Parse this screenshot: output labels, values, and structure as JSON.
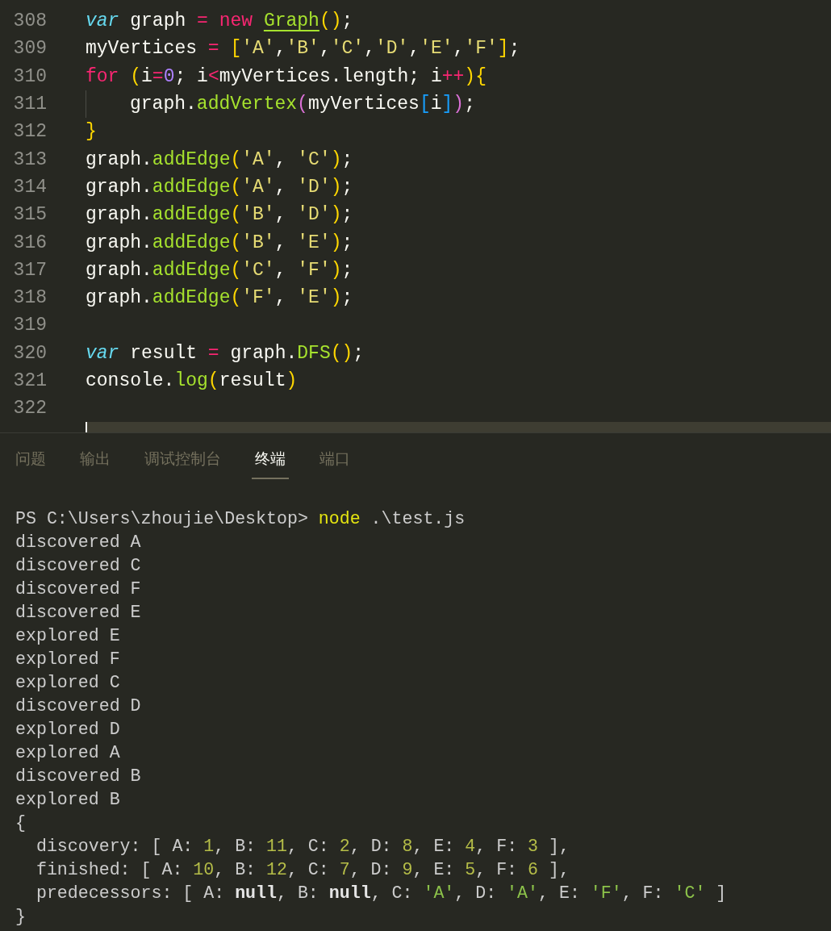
{
  "editor": {
    "lines": [
      {
        "number": "308",
        "indented": false,
        "tokens": [
          {
            "text": "var",
            "kind": "storage"
          },
          {
            "text": " graph ",
            "kind": "plain"
          },
          {
            "text": "=",
            "kind": "op"
          },
          {
            "text": " new ",
            "kind": "op"
          },
          {
            "text": "Graph",
            "kind": "class"
          },
          {
            "text": "()",
            "kind": "paren"
          },
          {
            "text": ";",
            "kind": "plain"
          }
        ]
      },
      {
        "number": "309",
        "indented": false,
        "tokens": [
          {
            "text": "myVertices ",
            "kind": "plain"
          },
          {
            "text": "=",
            "kind": "op"
          },
          {
            "text": " [",
            "kind": "paren"
          },
          {
            "text": "'A'",
            "kind": "string"
          },
          {
            "text": ",",
            "kind": "plain"
          },
          {
            "text": "'B'",
            "kind": "string"
          },
          {
            "text": ",",
            "kind": "plain"
          },
          {
            "text": "'C'",
            "kind": "string"
          },
          {
            "text": ",",
            "kind": "plain"
          },
          {
            "text": "'D'",
            "kind": "string"
          },
          {
            "text": ",",
            "kind": "plain"
          },
          {
            "text": "'E'",
            "kind": "string"
          },
          {
            "text": ",",
            "kind": "plain"
          },
          {
            "text": "'F'",
            "kind": "string"
          },
          {
            "text": "]",
            "kind": "paren"
          },
          {
            "text": ";",
            "kind": "plain"
          }
        ]
      },
      {
        "number": "310",
        "indented": false,
        "tokens": [
          {
            "text": "for",
            "kind": "op"
          },
          {
            "text": " (",
            "kind": "paren"
          },
          {
            "text": "i",
            "kind": "plain"
          },
          {
            "text": "=",
            "kind": "op"
          },
          {
            "text": "0",
            "kind": "number"
          },
          {
            "text": "; i",
            "kind": "plain"
          },
          {
            "text": "<",
            "kind": "op"
          },
          {
            "text": "myVertices.length; i",
            "kind": "plain"
          },
          {
            "text": "++",
            "kind": "op"
          },
          {
            "text": ")",
            "kind": "paren"
          },
          {
            "text": "{",
            "kind": "paren"
          }
        ]
      },
      {
        "number": "311",
        "indented": true,
        "tokens": [
          {
            "text": "graph.",
            "kind": "plain"
          },
          {
            "text": "addVertex",
            "kind": "func"
          },
          {
            "text": "(",
            "kind": "paren2"
          },
          {
            "text": "myVertices",
            "kind": "plain"
          },
          {
            "text": "[",
            "kind": "paren3"
          },
          {
            "text": "i",
            "kind": "plain"
          },
          {
            "text": "]",
            "kind": "paren3"
          },
          {
            "text": ")",
            "kind": "paren2"
          },
          {
            "text": ";",
            "kind": "plain"
          }
        ]
      },
      {
        "number": "312",
        "indented": false,
        "tokens": [
          {
            "text": "}",
            "kind": "paren"
          }
        ]
      },
      {
        "number": "313",
        "indented": false,
        "tokens": [
          {
            "text": "graph.",
            "kind": "plain"
          },
          {
            "text": "addEdge",
            "kind": "func"
          },
          {
            "text": "(",
            "kind": "paren"
          },
          {
            "text": "'A'",
            "kind": "string"
          },
          {
            "text": ", ",
            "kind": "plain"
          },
          {
            "text": "'C'",
            "kind": "string"
          },
          {
            "text": ")",
            "kind": "paren"
          },
          {
            "text": ";",
            "kind": "plain"
          }
        ]
      },
      {
        "number": "314",
        "indented": false,
        "tokens": [
          {
            "text": "graph.",
            "kind": "plain"
          },
          {
            "text": "addEdge",
            "kind": "func"
          },
          {
            "text": "(",
            "kind": "paren"
          },
          {
            "text": "'A'",
            "kind": "string"
          },
          {
            "text": ", ",
            "kind": "plain"
          },
          {
            "text": "'D'",
            "kind": "string"
          },
          {
            "text": ")",
            "kind": "paren"
          },
          {
            "text": ";",
            "kind": "plain"
          }
        ]
      },
      {
        "number": "315",
        "indented": false,
        "tokens": [
          {
            "text": "graph.",
            "kind": "plain"
          },
          {
            "text": "addEdge",
            "kind": "func"
          },
          {
            "text": "(",
            "kind": "paren"
          },
          {
            "text": "'B'",
            "kind": "string"
          },
          {
            "text": ", ",
            "kind": "plain"
          },
          {
            "text": "'D'",
            "kind": "string"
          },
          {
            "text": ")",
            "kind": "paren"
          },
          {
            "text": ";",
            "kind": "plain"
          }
        ]
      },
      {
        "number": "316",
        "indented": false,
        "tokens": [
          {
            "text": "graph.",
            "kind": "plain"
          },
          {
            "text": "addEdge",
            "kind": "func"
          },
          {
            "text": "(",
            "kind": "paren"
          },
          {
            "text": "'B'",
            "kind": "string"
          },
          {
            "text": ", ",
            "kind": "plain"
          },
          {
            "text": "'E'",
            "kind": "string"
          },
          {
            "text": ")",
            "kind": "paren"
          },
          {
            "text": ";",
            "kind": "plain"
          }
        ]
      },
      {
        "number": "317",
        "indented": false,
        "tokens": [
          {
            "text": "graph.",
            "kind": "plain"
          },
          {
            "text": "addEdge",
            "kind": "func"
          },
          {
            "text": "(",
            "kind": "paren"
          },
          {
            "text": "'C'",
            "kind": "string"
          },
          {
            "text": ", ",
            "kind": "plain"
          },
          {
            "text": "'F'",
            "kind": "string"
          },
          {
            "text": ")",
            "kind": "paren"
          },
          {
            "text": ";",
            "kind": "plain"
          }
        ]
      },
      {
        "number": "318",
        "indented": false,
        "tokens": [
          {
            "text": "graph.",
            "kind": "plain"
          },
          {
            "text": "addEdge",
            "kind": "func"
          },
          {
            "text": "(",
            "kind": "paren"
          },
          {
            "text": "'F'",
            "kind": "string"
          },
          {
            "text": ", ",
            "kind": "plain"
          },
          {
            "text": "'E'",
            "kind": "string"
          },
          {
            "text": ")",
            "kind": "paren"
          },
          {
            "text": ";",
            "kind": "plain"
          }
        ]
      },
      {
        "number": "319",
        "indented": false
      },
      {
        "number": "320",
        "indented": false,
        "tokens": [
          {
            "text": "var",
            "kind": "storage"
          },
          {
            "text": " result ",
            "kind": "plain"
          },
          {
            "text": "=",
            "kind": "op"
          },
          {
            "text": " graph.",
            "kind": "plain"
          },
          {
            "text": "DFS",
            "kind": "func"
          },
          {
            "text": "()",
            "kind": "paren"
          },
          {
            "text": ";",
            "kind": "plain"
          }
        ]
      },
      {
        "number": "321",
        "indented": false,
        "tokens": [
          {
            "text": "console.",
            "kind": "plain"
          },
          {
            "text": "log",
            "kind": "func"
          },
          {
            "text": "(",
            "kind": "paren"
          },
          {
            "text": "result",
            "kind": "plain"
          },
          {
            "text": ")",
            "kind": "paren"
          }
        ]
      },
      {
        "number": "322",
        "indented": false
      }
    ]
  },
  "panel": {
    "tabs": [
      {
        "label": "问题",
        "selected": false
      },
      {
        "label": "输出",
        "selected": false
      },
      {
        "label": "调试控制台",
        "selected": false
      },
      {
        "label": "终端",
        "selected": true
      },
      {
        "label": "端口",
        "selected": false
      }
    ]
  },
  "terminal": {
    "lines": [
      [
        {
          "text": "PS C:\\Users\\zhoujie\\Desktop> ",
          "kind": "plain"
        },
        {
          "text": "node",
          "kind": "command"
        },
        {
          "text": " .\\test.js",
          "kind": "plain"
        }
      ],
      [
        {
          "text": "discovered A",
          "kind": "plain"
        }
      ],
      [
        {
          "text": "discovered C",
          "kind": "plain"
        }
      ],
      [
        {
          "text": "discovered F",
          "kind": "plain"
        }
      ],
      [
        {
          "text": "discovered E",
          "kind": "plain"
        }
      ],
      [
        {
          "text": "explored E",
          "kind": "plain"
        }
      ],
      [
        {
          "text": "explored F",
          "kind": "plain"
        }
      ],
      [
        {
          "text": "explored C",
          "kind": "plain"
        }
      ],
      [
        {
          "text": "discovered D",
          "kind": "plain"
        }
      ],
      [
        {
          "text": "explored D",
          "kind": "plain"
        }
      ],
      [
        {
          "text": "explored A",
          "kind": "plain"
        }
      ],
      [
        {
          "text": "discovered B",
          "kind": "plain"
        }
      ],
      [
        {
          "text": "explored B",
          "kind": "plain"
        }
      ],
      [
        {
          "text": "{",
          "kind": "plain"
        }
      ],
      [
        {
          "text": "  discovery: [ A: ",
          "kind": "plain"
        },
        {
          "text": "1",
          "kind": "number"
        },
        {
          "text": ", B: ",
          "kind": "plain"
        },
        {
          "text": "11",
          "kind": "number"
        },
        {
          "text": ", C: ",
          "kind": "plain"
        },
        {
          "text": "2",
          "kind": "number"
        },
        {
          "text": ", D: ",
          "kind": "plain"
        },
        {
          "text": "8",
          "kind": "number"
        },
        {
          "text": ", E: ",
          "kind": "plain"
        },
        {
          "text": "4",
          "kind": "number"
        },
        {
          "text": ", F: ",
          "kind": "plain"
        },
        {
          "text": "3",
          "kind": "number"
        },
        {
          "text": " ],",
          "kind": "plain"
        }
      ],
      [
        {
          "text": "  finished: [ A: ",
          "kind": "plain"
        },
        {
          "text": "10",
          "kind": "number"
        },
        {
          "text": ", B: ",
          "kind": "plain"
        },
        {
          "text": "12",
          "kind": "number"
        },
        {
          "text": ", C: ",
          "kind": "plain"
        },
        {
          "text": "7",
          "kind": "number"
        },
        {
          "text": ", D: ",
          "kind": "plain"
        },
        {
          "text": "9",
          "kind": "number"
        },
        {
          "text": ", E: ",
          "kind": "plain"
        },
        {
          "text": "5",
          "kind": "number"
        },
        {
          "text": ", F: ",
          "kind": "plain"
        },
        {
          "text": "6",
          "kind": "number"
        },
        {
          "text": " ],",
          "kind": "plain"
        }
      ],
      [
        {
          "text": "  predecessors: [ A: ",
          "kind": "plain"
        },
        {
          "text": "null",
          "kind": "null"
        },
        {
          "text": ", B: ",
          "kind": "plain"
        },
        {
          "text": "null",
          "kind": "null"
        },
        {
          "text": ", C: ",
          "kind": "plain"
        },
        {
          "text": "'A'",
          "kind": "string"
        },
        {
          "text": ", D: ",
          "kind": "plain"
        },
        {
          "text": "'A'",
          "kind": "string"
        },
        {
          "text": ", E: ",
          "kind": "plain"
        },
        {
          "text": "'F'",
          "kind": "string"
        },
        {
          "text": ", F: ",
          "kind": "plain"
        },
        {
          "text": "'C'",
          "kind": "string"
        },
        {
          "text": " ]",
          "kind": "plain"
        }
      ],
      [
        {
          "text": "}",
          "kind": "plain"
        }
      ]
    ]
  }
}
